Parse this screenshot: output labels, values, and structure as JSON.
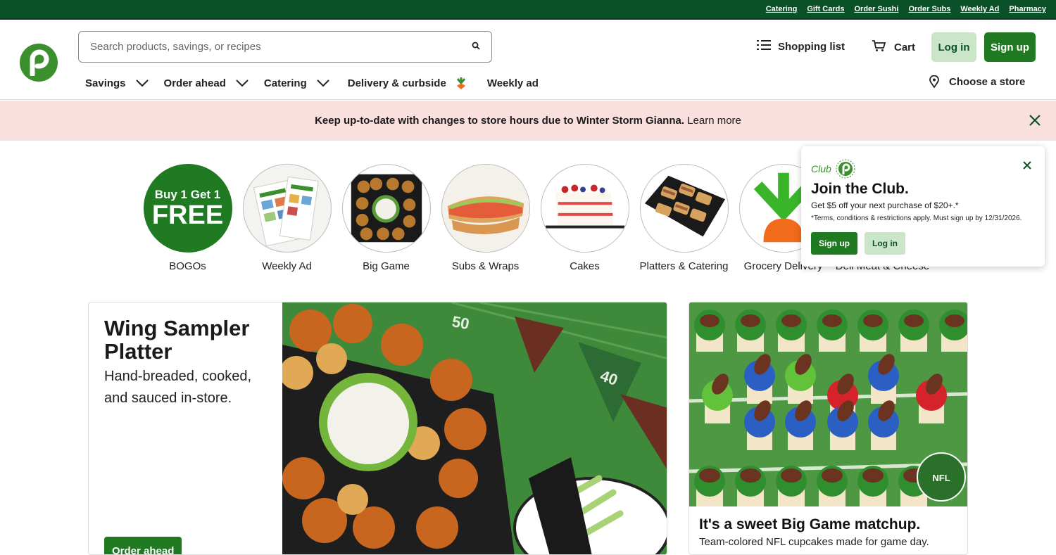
{
  "utility_links": [
    "Catering",
    "Gift Cards",
    "Order Sushi",
    "Order Subs",
    "Weekly Ad",
    "Pharmacy"
  ],
  "search": {
    "placeholder": "Search products, savings, or recipes"
  },
  "header": {
    "shopping_list": "Shopping list",
    "cart": "Cart",
    "login": "Log in",
    "signup": "Sign up",
    "choose_store": "Choose a store"
  },
  "nav": [
    "Savings",
    "Order ahead",
    "Catering",
    "Delivery & curbside",
    "Weekly ad"
  ],
  "alert": {
    "message": "Keep up-to-date with changes to store hours due to Winter Storm Gianna.",
    "link": "Learn more"
  },
  "categories": [
    {
      "label": "BOGOs",
      "badge_line1": "Buy 1 Get 1",
      "badge_line2": "FREE"
    },
    {
      "label": "Weekly Ad"
    },
    {
      "label": "Big Game"
    },
    {
      "label": "Subs & Wraps"
    },
    {
      "label": "Cakes"
    },
    {
      "label": "Platters & Catering"
    },
    {
      "label": "Grocery Delivery"
    },
    {
      "label": "Deli Meat & Cheese"
    }
  ],
  "club": {
    "brand": "Club",
    "title": "Join the Club.",
    "offer": "Get $5 off your next purchase of $20+.*",
    "terms": "*Terms, conditions & restrictions apply. Must sign up by 12/31/2026.",
    "signup": "Sign up",
    "login": "Log in"
  },
  "hero": {
    "title": "Wing Sampler Platter",
    "subtitle": "Hand-breaded, cooked, and sauced in-store.",
    "button": "Order ahead",
    "yard_a": "50",
    "yard_b": "40"
  },
  "promo": {
    "title": "It's a sweet Big Game matchup.",
    "subtitle": "Team-colored NFL cupcakes made for game day.",
    "badge": "NFL"
  },
  "colors": {
    "brand_dark": "#0b5128",
    "brand": "#1f7a22",
    "brand_light": "#cbe5c8",
    "alert_bg": "#f9e0df"
  }
}
